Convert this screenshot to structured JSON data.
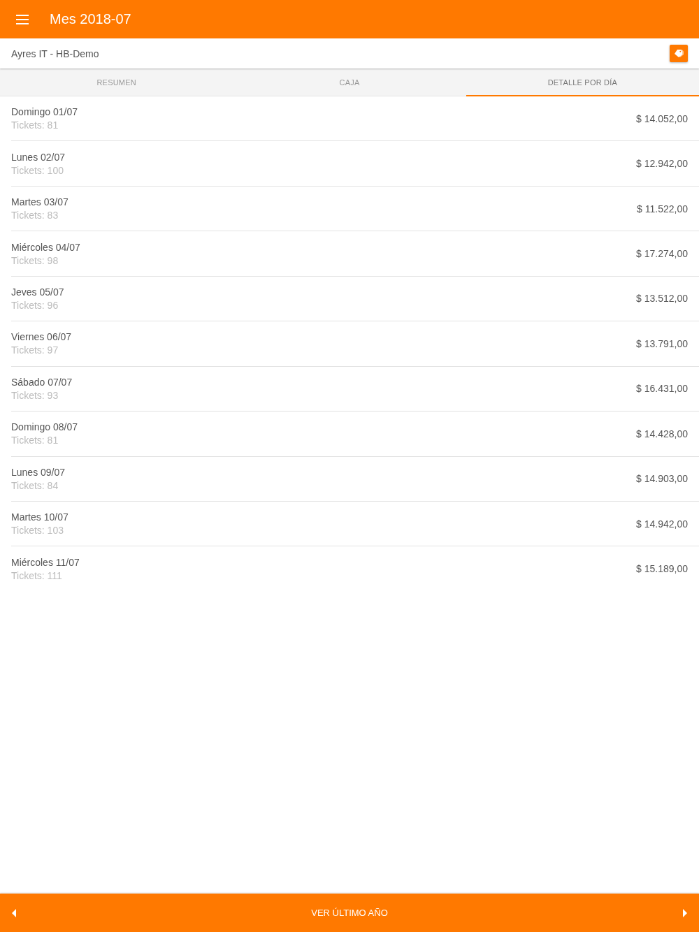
{
  "app_bar": {
    "title": "Mes 2018-07"
  },
  "account": {
    "name": "Ayres IT - HB-Demo"
  },
  "tabs": [
    {
      "label": "RESUMEN",
      "selected": false
    },
    {
      "label": "CAJA",
      "selected": false
    },
    {
      "label": "DETALLE POR DÍA",
      "selected": true
    }
  ],
  "days": [
    {
      "day": "Domingo 01/07",
      "tickets": "Tickets: 81",
      "amount": "$ 14.052,00"
    },
    {
      "day": "Lunes 02/07",
      "tickets": "Tickets: 100",
      "amount": "$ 12.942,00"
    },
    {
      "day": "Martes 03/07",
      "tickets": "Tickets: 83",
      "amount": "$ 11.522,00"
    },
    {
      "day": "Miércoles 04/07",
      "tickets": "Tickets: 98",
      "amount": "$ 17.274,00"
    },
    {
      "day": "Jeves 05/07",
      "tickets": "Tickets: 96",
      "amount": "$ 13.512,00"
    },
    {
      "day": "Viernes 06/07",
      "tickets": "Tickets: 97",
      "amount": "$ 13.791,00"
    },
    {
      "day": "Sábado 07/07",
      "tickets": "Tickets: 93",
      "amount": "$ 16.431,00"
    },
    {
      "day": "Domingo 08/07",
      "tickets": "Tickets: 81",
      "amount": "$ 14.428,00"
    },
    {
      "day": "Lunes 09/07",
      "tickets": "Tickets: 84",
      "amount": "$ 14.903,00"
    },
    {
      "day": "Martes 10/07",
      "tickets": "Tickets: 103",
      "amount": "$ 14.942,00"
    },
    {
      "day": "Miércoles 11/07",
      "tickets": "Tickets: 111",
      "amount": "$ 15.189,00"
    }
  ],
  "bottom_bar": {
    "label": "VER ÚLTIMO AÑO"
  }
}
